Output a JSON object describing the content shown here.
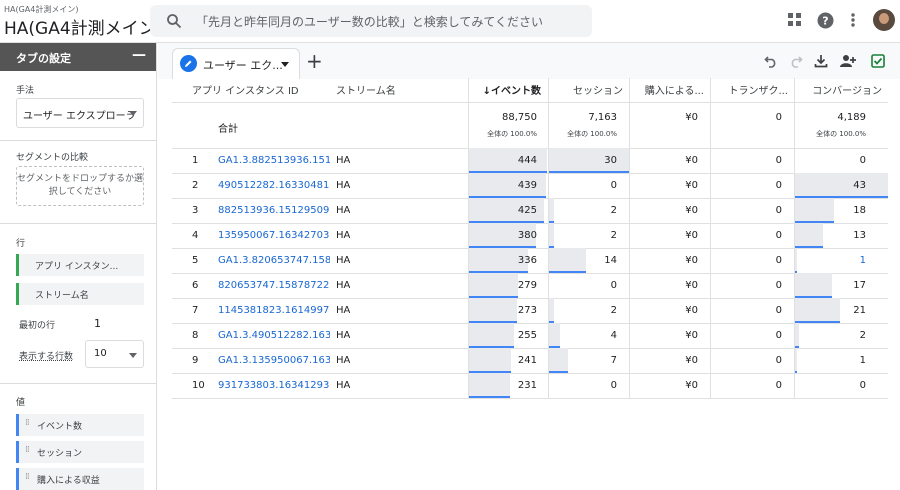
{
  "header": {
    "property_small": "HA(GA4計測メイン)",
    "property_big": "HA(GA4計測メイン)",
    "search_placeholder": "「先月と昨年同月のユーザー数の比較」と検索してみてください"
  },
  "icons": {
    "search": "search-icon",
    "apps": "apps-grid-icon",
    "help": "help-icon",
    "more": "more-vert-icon",
    "avatar": "avatar",
    "pencil": "pencil-icon",
    "undo": "undo-icon",
    "redo": "redo-icon",
    "download": "download-icon",
    "share": "add-user-icon",
    "check": "check-box-icon"
  },
  "panel": {
    "title": "タブの設定",
    "technique_label": "手法",
    "technique_value": "ユーザー エクスプローラ",
    "segment_label": "セグメントの比較",
    "segment_drop": "セグメントをドロップするか選択してください",
    "rows_label": "行",
    "row_chips": [
      "アプリ インスタン...",
      "ストリーム名"
    ],
    "first_row_label": "最初の行",
    "first_row_value": "1",
    "rows_shown_label": "表示する行数",
    "rows_shown_value": "10",
    "values_label": "値",
    "value_chips": [
      "イベント数",
      "セッション",
      "購入による収益"
    ]
  },
  "tab": {
    "label": "ユーザー エク...",
    "add": "+"
  },
  "table": {
    "columns": [
      "アプリ インスタンス ID",
      "ストリーム名",
      "↓イベント数",
      "セッション",
      "購入による...",
      "トランザク...",
      "コンバージョン"
    ],
    "totals": {
      "label": "合計",
      "events": "88,750",
      "events_sub": "全体の 100.0%",
      "sessions": "7,163",
      "sessions_sub": "全体の 100.0%",
      "revenue": "¥0",
      "transactions": "0",
      "conversions": "4,189",
      "conversions_sub": "全体の 100.0%"
    },
    "rows": [
      {
        "n": "1",
        "id": "GA1.3.882513936.151...",
        "stream": "HA",
        "events": "444",
        "events_v": 444,
        "sessions": "30",
        "sessions_v": 30,
        "revenue": "¥0",
        "transactions": "0",
        "conversions": "0",
        "conversions_v": 0
      },
      {
        "n": "2",
        "id": "490512282.16330481...",
        "stream": "HA",
        "events": "439",
        "events_v": 439,
        "sessions": "0",
        "sessions_v": 0,
        "revenue": "¥0",
        "transactions": "0",
        "conversions": "43",
        "conversions_v": 43
      },
      {
        "n": "3",
        "id": "882513936.15129509...",
        "stream": "HA",
        "events": "425",
        "events_v": 425,
        "sessions": "2",
        "sessions_v": 2,
        "revenue": "¥0",
        "transactions": "0",
        "conversions": "18",
        "conversions_v": 18
      },
      {
        "n": "4",
        "id": "135950067.16342703...",
        "stream": "HA",
        "events": "380",
        "events_v": 380,
        "sessions": "2",
        "sessions_v": 2,
        "revenue": "¥0",
        "transactions": "0",
        "conversions": "13",
        "conversions_v": 13
      },
      {
        "n": "5",
        "id": "GA1.3.820653747.158...",
        "stream": "HA",
        "events": "336",
        "events_v": 336,
        "sessions": "14",
        "sessions_v": 14,
        "revenue": "¥0",
        "transactions": "0",
        "conversions": "1",
        "conversions_v": 1,
        "conv_link": true
      },
      {
        "n": "6",
        "id": "820653747.15878722...",
        "stream": "HA",
        "events": "279",
        "events_v": 279,
        "sessions": "0",
        "sessions_v": 0,
        "revenue": "¥0",
        "transactions": "0",
        "conversions": "17",
        "conversions_v": 17
      },
      {
        "n": "7",
        "id": "1145381823.1614997...",
        "stream": "HA",
        "events": "273",
        "events_v": 273,
        "sessions": "2",
        "sessions_v": 2,
        "revenue": "¥0",
        "transactions": "0",
        "conversions": "21",
        "conversions_v": 21
      },
      {
        "n": "8",
        "id": "GA1.3.490512282.163...",
        "stream": "HA",
        "events": "255",
        "events_v": 255,
        "sessions": "4",
        "sessions_v": 4,
        "revenue": "¥0",
        "transactions": "0",
        "conversions": "2",
        "conversions_v": 2
      },
      {
        "n": "9",
        "id": "GA1.3.135950067.163...",
        "stream": "HA",
        "events": "241",
        "events_v": 241,
        "sessions": "7",
        "sessions_v": 7,
        "revenue": "¥0",
        "transactions": "0",
        "conversions": "1",
        "conversions_v": 1
      },
      {
        "n": "10",
        "id": "931733803.16341293...",
        "stream": "HA",
        "events": "231",
        "events_v": 231,
        "sessions": "0",
        "sessions_v": 0,
        "revenue": "¥0",
        "transactions": "0",
        "conversions": "0",
        "conversions_v": 0
      }
    ]
  }
}
